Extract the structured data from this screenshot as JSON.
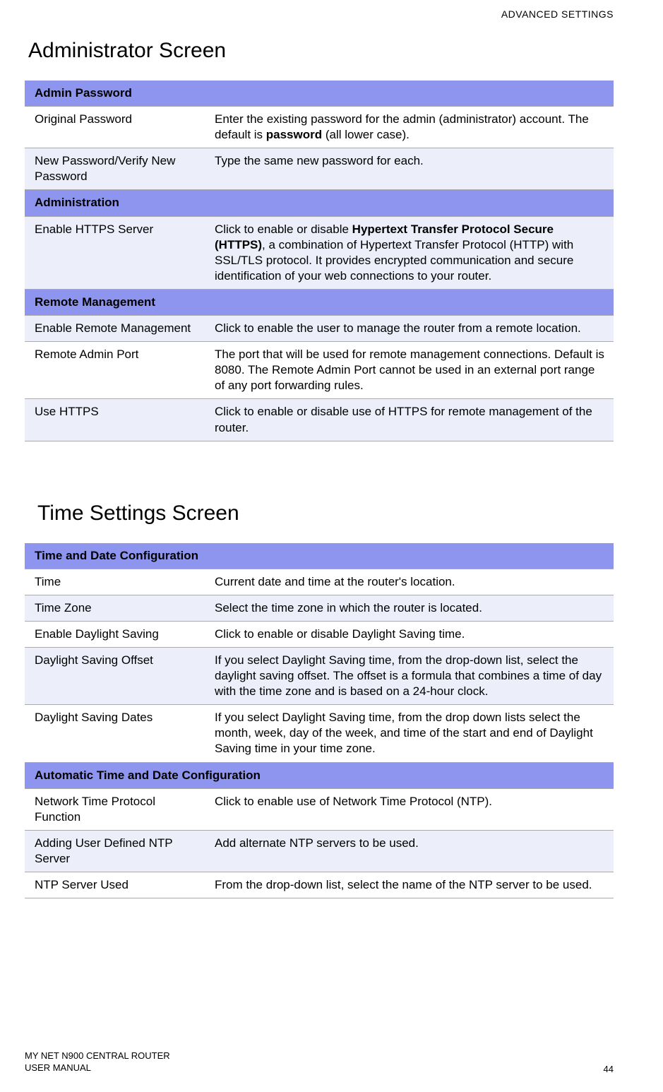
{
  "header_label": "ADVANCED SETTINGS",
  "h1_admin": "Administrator Screen",
  "h1_time": "Time Settings Screen",
  "admin_table": {
    "sec1": "Admin Password",
    "r1_label": "Original Password",
    "r1_desc_a": "Enter the existing password for the admin (administrator) account. The default is ",
    "r1_desc_bold": "password",
    "r1_desc_b": " (all lower case).",
    "r2_label": "New Password/Verify New Password",
    "r2_desc": "Type the same new password for each.",
    "sec2": "Administration",
    "r3_label": "Enable HTTPS Server",
    "r3_desc_a": "Click to enable or disable ",
    "r3_desc_bold": "Hypertext Transfer Protocol Secure (HTTPS)",
    "r3_desc_b": ", a combination of Hypertext Transfer Protocol (HTTP) with SSL/TLS protocol. It provides encrypted communication and secure identification of your web connections to your router.",
    "sec3": "Remote Management",
    "r4_label": "Enable Remote Management",
    "r4_desc": "Click to enable the user to manage the router from a remote location.",
    "r5_label": "Remote Admin Port",
    "r5_desc": "The port that will be used for remote management connections. Default is 8080. The Remote Admin Port cannot be used in an external port range of any port forwarding rules.",
    "r6_label": "Use HTTPS",
    "r6_desc": "Click to enable or disable use of HTTPS for remote management of the router."
  },
  "time_table": {
    "sec1": "Time and Date Configuration",
    "r1_label": "Time",
    "r1_desc": "Current date and time at the router's location.",
    "r2_label": "Time Zone",
    "r2_desc": "Select the time zone in which the router is located.",
    "r3_label": "Enable Daylight Saving",
    "r3_desc": "Click to enable or disable Daylight Saving time.",
    "r4_label": "Daylight Saving Offset",
    "r4_desc": "If you select Daylight Saving time, from the drop-down list, select the daylight saving offset. The offset is a formula that combines a time of day with the time zone and is based on a 24-hour clock.",
    "r5_label": "Daylight Saving Dates",
    "r5_desc": "If you select Daylight Saving time, from the drop down lists select the month, week, day of the week, and time of the start and end of Daylight Saving time in your time zone.",
    "sec2": "Automatic Time and Date Configuration",
    "r6_label": "Network Time Protocol Function",
    "r6_desc": "Click to enable use of Network Time Protocol (NTP).",
    "r7_label": "Adding User Defined NTP Server",
    "r7_desc": "Add alternate NTP servers to be used.",
    "r8_label": "NTP Server Used",
    "r8_desc": "From the drop-down list, select the name of the NTP server to be used."
  },
  "footer": {
    "line1": "MY NET N900 CENTRAL ROUTER",
    "line2": "USER MANUAL",
    "page": "44"
  }
}
